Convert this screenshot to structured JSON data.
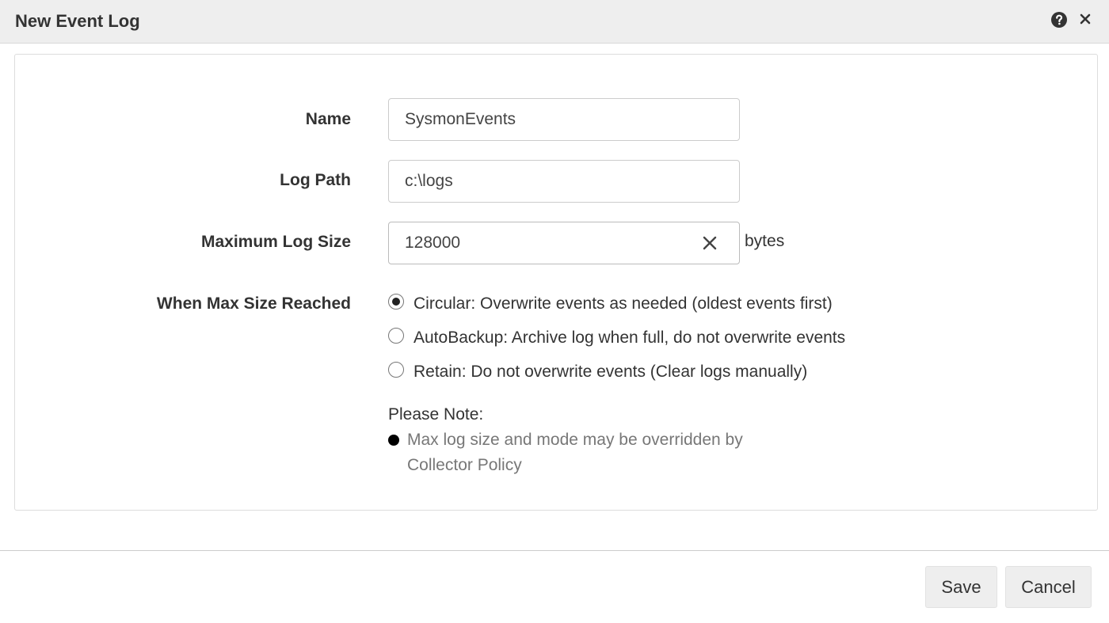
{
  "dialog": {
    "title": "New Event Log",
    "help_icon": "question-circle-icon",
    "close_icon": "close-icon"
  },
  "form": {
    "name": {
      "label": "Name",
      "value": "SysmonEvents"
    },
    "log_path": {
      "label": "Log Path",
      "value": "c:\\logs"
    },
    "max_log_size": {
      "label": "Maximum Log Size",
      "value": "128000",
      "unit": "bytes",
      "clear_icon": "clear-x-icon"
    },
    "when_max_size_reached": {
      "label": "When Max Size Reached",
      "selected": "circular",
      "options": [
        {
          "id": "circular",
          "label": "Circular: Overwrite events as needed (oldest events first)"
        },
        {
          "id": "autobackup",
          "label": "AutoBackup: Archive log when full, do not overwrite events"
        },
        {
          "id": "retain",
          "label": "Retain: Do not overwrite events (Clear logs manually)"
        }
      ]
    },
    "note": {
      "title": "Please Note:",
      "items": [
        "Max log size and mode may be overridden by Collector Policy"
      ]
    }
  },
  "footer": {
    "save_label": "Save",
    "cancel_label": "Cancel"
  },
  "colors": {
    "titlebar_bg": "#eeeeee",
    "button_bg": "#eeeeee",
    "note_text": "#777777"
  }
}
